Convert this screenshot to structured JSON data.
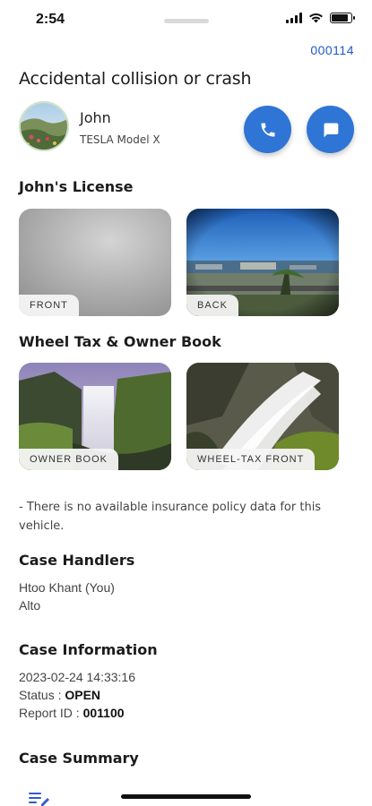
{
  "status_bar": {
    "time": "2:54",
    "battery_level": 0.85
  },
  "case": {
    "id": "000114",
    "title": "Accidental collision or crash"
  },
  "person": {
    "name": "John",
    "vehicle": "TESLA Model X"
  },
  "icons": {
    "call": "phone-icon",
    "message": "chat-bubble-icon",
    "nav": "list-edit-icon"
  },
  "colors": {
    "accent": "#2f75d6",
    "link": "#1f58c8"
  },
  "license": {
    "heading": "John's License",
    "front_label": "FRONT",
    "back_label": "BACK"
  },
  "wheel_tax": {
    "heading": "Wheel Tax & Owner Book",
    "owner_book_label": "OWNER BOOK",
    "wheel_tax_front_label": "WHEEL-TAX FRONT"
  },
  "insurance_note": "- There is no available insurance policy data for this vehicle.",
  "handlers": {
    "heading": "Case Handlers",
    "names": [
      "Htoo Khant (You)",
      "Alto"
    ]
  },
  "info": {
    "heading": "Case Information",
    "datetime": "2023-02-24 14:33:16",
    "status_label": "Status :",
    "status_value": "OPEN",
    "report_label": "Report ID :",
    "report_value": "001100"
  },
  "summary": {
    "heading": "Case Summary"
  }
}
